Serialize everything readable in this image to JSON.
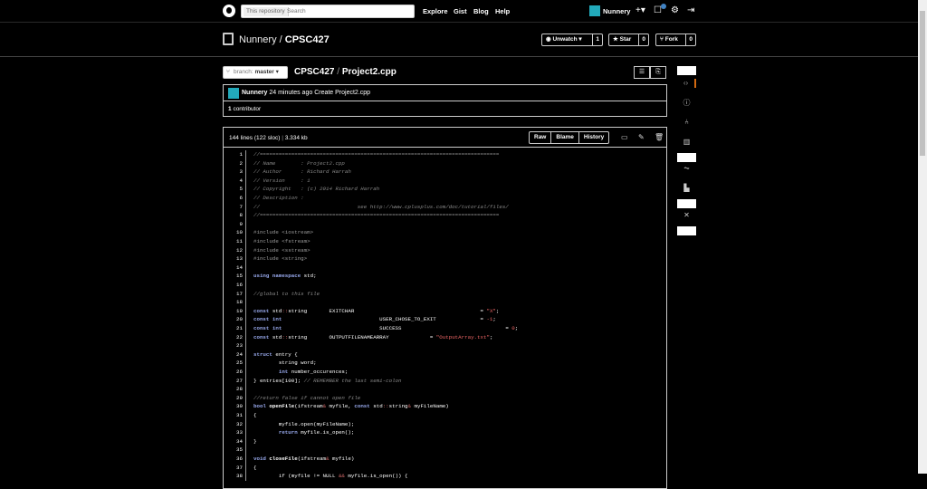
{
  "header": {
    "search_scope": "This repository",
    "search_placeholder": "Search",
    "nav": [
      "Explore",
      "Gist",
      "Blog",
      "Help"
    ],
    "username": "Nunnery"
  },
  "repo": {
    "owner": "Nunnery",
    "separator": "/",
    "name": "CPSC427",
    "watch_label": "Unwatch",
    "watch_count": "1",
    "star_label": "Star",
    "star_count": "0",
    "fork_label": "Fork",
    "fork_count": "0"
  },
  "file_nav": {
    "branch_key": "branch:",
    "branch": "master",
    "path_root": "CPSC427",
    "path_sep": "/",
    "file_name": "Project2.cpp"
  },
  "commit": {
    "author": "Nunnery",
    "time": "24 minutes ago",
    "message": "Create Project2.cpp",
    "contributors_count": "1",
    "contributors_label": "contributor"
  },
  "file": {
    "lines_info": "144 lines (122 sloc)",
    "size": "3.334 kb",
    "raw_label": "Raw",
    "blame_label": "Blame",
    "history_label": "History"
  },
  "code_lines": [
    {
      "n": "1",
      "t": "//============================================================================",
      "c": "cm"
    },
    {
      "n": "2",
      "t": "// Name        : Project2.cpp",
      "c": "cm"
    },
    {
      "n": "3",
      "t": "// Author      : Richard Harrah",
      "c": "cm"
    },
    {
      "n": "4",
      "t": "// Version     : 1",
      "c": "cm"
    },
    {
      "n": "5",
      "t": "// Copyright   : (c) 2014 Richard Harrah",
      "c": "cm"
    },
    {
      "n": "6",
      "t": "// Description :",
      "c": "cm"
    },
    {
      "n": "7",
      "t": "//                               see http://www.cplusplus.com/doc/tutorial/files/",
      "c": "cm"
    },
    {
      "n": "8",
      "t": "//============================================================================",
      "c": "cm"
    },
    {
      "n": "9",
      "t": "",
      "c": ""
    },
    {
      "n": "10",
      "t": "#include <iostream>",
      "c": "pp"
    },
    {
      "n": "11",
      "t": "#include <fstream>",
      "c": "pp"
    },
    {
      "n": "12",
      "t": "#include <sstream>",
      "c": "pp"
    },
    {
      "n": "13",
      "t": "#include <string>",
      "c": "pp"
    },
    {
      "n": "14",
      "t": "",
      "c": ""
    },
    {
      "n": "15",
      "t": "using namespace std;",
      "c": "kwline"
    },
    {
      "n": "16",
      "t": "",
      "c": ""
    },
    {
      "n": "17",
      "t": "//global to this file",
      "c": "cm"
    },
    {
      "n": "18",
      "t": "",
      "c": ""
    },
    {
      "n": "19",
      "t": "const std::string       EXITCHAR                                        = \"X\";",
      "c": "decl"
    },
    {
      "n": "20",
      "t": "const int                               USER_CHOSE_TO_EXIT              = -1;",
      "c": "decl"
    },
    {
      "n": "21",
      "t": "const int                               SUCCESS                                 = 0;",
      "c": "decl"
    },
    {
      "n": "22",
      "t": "const std::string       OUTPUTFILENAMEARRAY             = \"OutputArray.txt\";",
      "c": "decl"
    },
    {
      "n": "23",
      "t": "",
      "c": ""
    },
    {
      "n": "24",
      "t": "struct entry {",
      "c": "kwline"
    },
    {
      "n": "25",
      "t": "        string word;",
      "c": ""
    },
    {
      "n": "26",
      "t": "        int number_occurences;",
      "c": ""
    },
    {
      "n": "27",
      "t": "} entries[100]; // REMEMBER the last semi-colon",
      "c": "mixed"
    },
    {
      "n": "28",
      "t": "",
      "c": ""
    },
    {
      "n": "29",
      "t": "//return false if cannot open file",
      "c": "cm"
    },
    {
      "n": "30",
      "t": "bool openFile(ifstream& myfile, const std::string& myFileName)",
      "c": "fnline"
    },
    {
      "n": "31",
      "t": "{",
      "c": ""
    },
    {
      "n": "32",
      "t": "        myfile.open(myFileName);",
      "c": ""
    },
    {
      "n": "33",
      "t": "        return myfile.is_open();",
      "c": ""
    },
    {
      "n": "34",
      "t": "}",
      "c": ""
    },
    {
      "n": "35",
      "t": "",
      "c": ""
    },
    {
      "n": "36",
      "t": "void closeFile(ifstream& myfile)",
      "c": "fnline"
    },
    {
      "n": "37",
      "t": "{",
      "c": ""
    },
    {
      "n": "38",
      "t": "        if (myfile != NULL && myfile.is_open()) {",
      "c": ""
    }
  ]
}
